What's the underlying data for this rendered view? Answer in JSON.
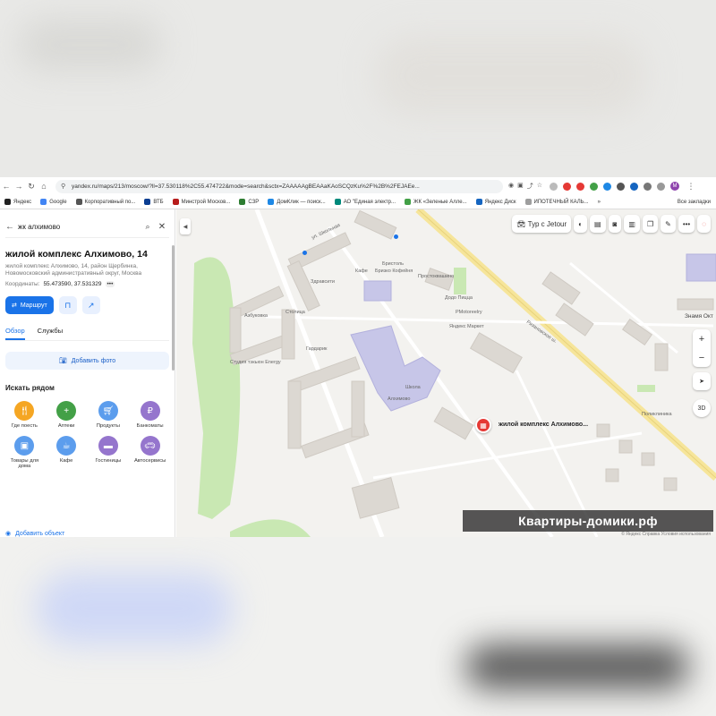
{
  "browser": {
    "url": "yandex.ru/maps/213/moscow/?ll=37.530118%2C55.474722&mode=search&sctx=ZAAAAAgBEAAaKAoSCQzKu%2F%2B%2FEJAEe...",
    "bookmarks": [
      {
        "label": "Яндекс",
        "color": "#222222"
      },
      {
        "label": "Google",
        "color": "#4285f4"
      },
      {
        "label": "Корпоративный по...",
        "color": "#555555"
      },
      {
        "label": "ВТБ",
        "color": "#0a3d91"
      },
      {
        "label": "Минстрой Москов...",
        "color": "#b71c1c"
      },
      {
        "label": "СЗР",
        "color": "#2e7d32"
      },
      {
        "label": "ДомКлик — поиск...",
        "color": "#1e88e5"
      },
      {
        "label": "АО \"Единая электр...",
        "color": "#00897b"
      },
      {
        "label": "ЖК «Зеленые Алле...",
        "color": "#43a047"
      },
      {
        "label": "Яндекс Диск",
        "color": "#1565c0"
      },
      {
        "label": "ИПОТЕЧНЫЙ КАЛЬ...",
        "color": "#9e9e9e"
      }
    ],
    "all_bookmarks": "Все закладки",
    "profile_initial": "М"
  },
  "sidebar": {
    "search_query": "жк алхимово",
    "place_title": "жилой комплекс Алхимово, 14",
    "place_address": "жилой комплекс Алхимово, 14, район Щербинка, Новомосковский административный округ, Москва",
    "coords_label": "Координаты:",
    "coords_value": "55.473590, 37.531329",
    "coords_more": "•••",
    "route_label": "Маршрут",
    "tabs": [
      "Обзор",
      "Службы"
    ],
    "add_photo": "Добавить фото",
    "nearby_title": "Искать рядом",
    "categories": [
      {
        "label": "Где поесть",
        "icon": "fork-icon",
        "color": "#f5a623"
      },
      {
        "label": "Аптеки",
        "icon": "plus-icon",
        "color": "#43a047"
      },
      {
        "label": "Продукты",
        "icon": "basket-icon",
        "color": "#5c9ded"
      },
      {
        "label": "Банкоматы",
        "icon": "ruble-icon",
        "color": "#9575cd"
      },
      {
        "label": "Товары для дома",
        "icon": "box-icon",
        "color": "#5c9ded"
      },
      {
        "label": "Кафе",
        "icon": "cup-icon",
        "color": "#5c9ded"
      },
      {
        "label": "Гостиницы",
        "icon": "bed-icon",
        "color": "#9575cd"
      },
      {
        "label": "Автосервисы",
        "icon": "car-icon",
        "color": "#9575cd"
      }
    ],
    "add_object": "Добавить объект"
  },
  "map": {
    "route_chip": "Тур с Jetour",
    "marker_label": "жилой комплекс Алхимово...",
    "labels": [
      {
        "text": "Здравсити"
      },
      {
        "text": "Бристоль"
      },
      {
        "text": "Кафе"
      },
      {
        "text": "Бризко Кофейня"
      },
      {
        "text": "Простоквашино"
      },
      {
        "text": "Додо Пицца"
      },
      {
        "text": "Яндекс Маркет"
      },
      {
        "text": "PMotoreelry"
      },
      {
        "text": "Столица"
      },
      {
        "text": "Азбуковка"
      },
      {
        "text": "Студия тэкьюн Energy"
      },
      {
        "text": "Гардарик"
      },
      {
        "text": "Школа"
      },
      {
        "text": "Алхимово"
      },
      {
        "text": "Поликлиника"
      },
      {
        "text": "Знамя Окт"
      },
      {
        "text": "Рязановское ш."
      },
      {
        "text": "ул. Школьная"
      }
    ],
    "zoom_in": "+",
    "zoom_out": "−",
    "view3d": "3D",
    "watermark": "Квартиры-домики.рф",
    "copyright": "© Яндекс  Справка  Условия использования"
  },
  "colors": {
    "accent": "#1a73e8",
    "marker": "#e53935",
    "park": "#c9e8b3",
    "road_main": "#f6e59a",
    "building": "#dcd8d2",
    "school": "#c7c6e8"
  }
}
